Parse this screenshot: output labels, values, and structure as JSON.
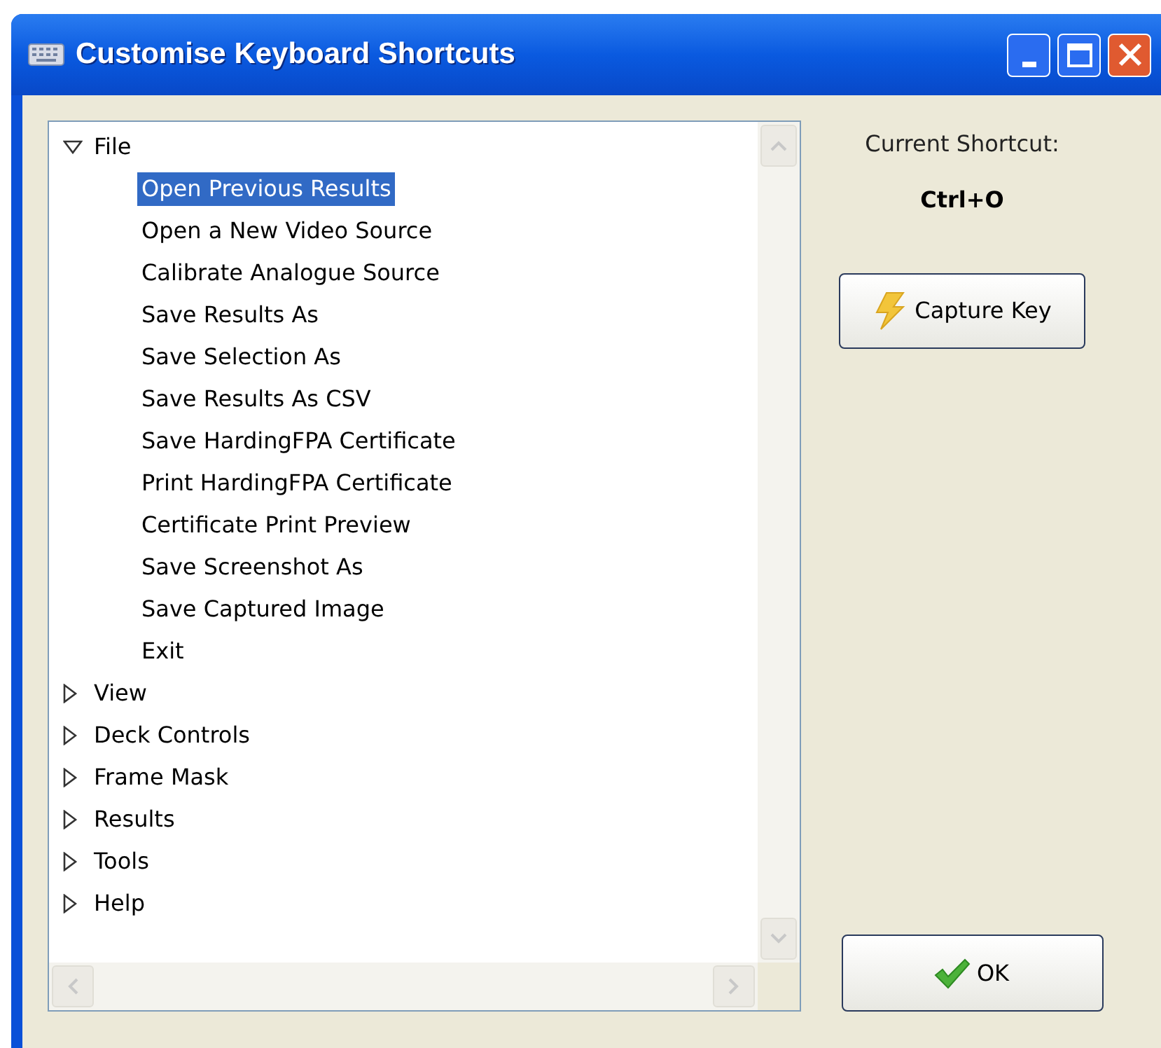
{
  "window": {
    "title": "Customise Keyboard Shortcuts"
  },
  "tree": [
    {
      "label": "File",
      "expanded": true,
      "children": [
        {
          "label": "Open Previous Results",
          "selected": true
        },
        {
          "label": "Open a New Video Source",
          "selected": false
        },
        {
          "label": "Calibrate Analogue Source",
          "selected": false
        },
        {
          "label": "Save Results As",
          "selected": false
        },
        {
          "label": "Save Selection As",
          "selected": false
        },
        {
          "label": "Save Results As CSV",
          "selected": false
        },
        {
          "label": "Save HardingFPA Certificate",
          "selected": false
        },
        {
          "label": "Print HardingFPA Certificate",
          "selected": false
        },
        {
          "label": "Certificate Print Preview",
          "selected": false
        },
        {
          "label": "Save Screenshot As",
          "selected": false
        },
        {
          "label": "Save Captured Image",
          "selected": false
        },
        {
          "label": "Exit",
          "selected": false
        }
      ]
    },
    {
      "label": "View",
      "expanded": false
    },
    {
      "label": "Deck Controls",
      "expanded": false
    },
    {
      "label": "Frame Mask",
      "expanded": false
    },
    {
      "label": "Results",
      "expanded": false
    },
    {
      "label": "Tools",
      "expanded": false
    },
    {
      "label": "Help",
      "expanded": false
    }
  ],
  "current_shortcut": {
    "label": "Current Shortcut:",
    "value": "Ctrl+O"
  },
  "buttons": [
    {
      "kind": "capture",
      "label": "Capture Key"
    },
    {
      "kind": "ok",
      "label": "OK"
    }
  ]
}
